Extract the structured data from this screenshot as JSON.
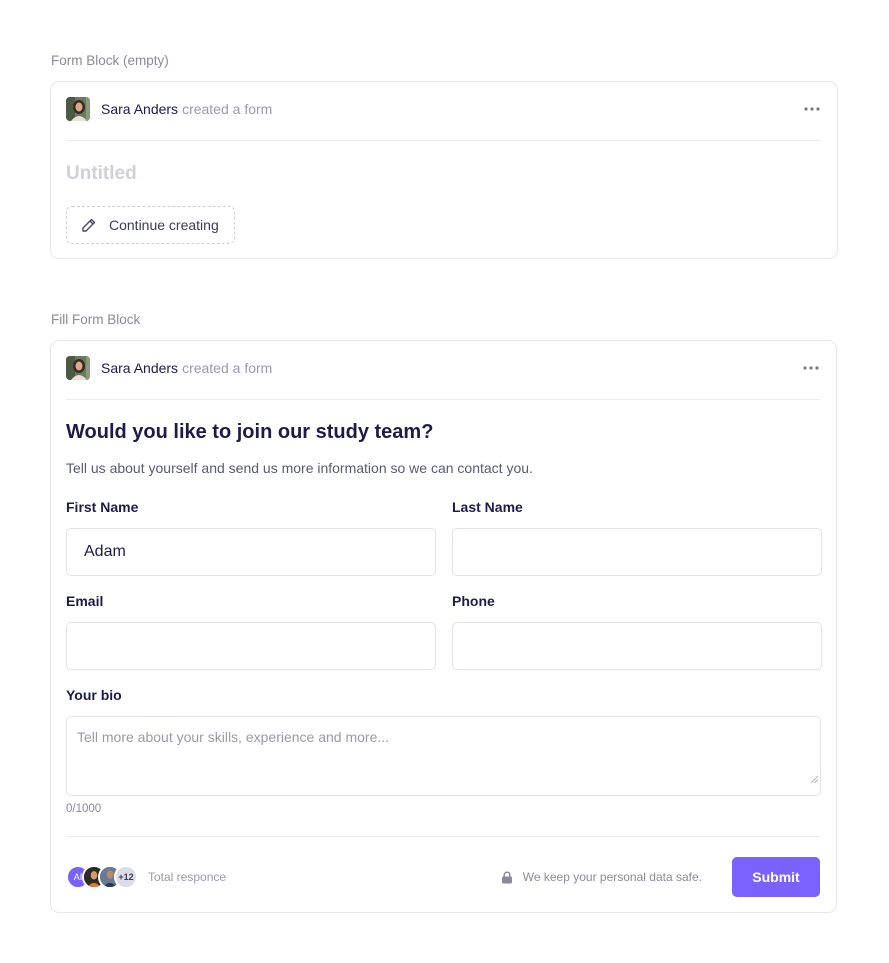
{
  "empty_block": {
    "section_label": "Form Block (empty)",
    "author": "Sara Anders",
    "action": "created a form",
    "title": "Untitled",
    "continue_label": "Continue creating"
  },
  "fill_block": {
    "section_label": "Fill Form Block",
    "author": "Sara Anders",
    "action": "created a form",
    "title": "Would you like to join our study team?",
    "description": "Tell us about yourself and send us more information so we can contact you.",
    "fields": {
      "first_name": {
        "label": "First Name",
        "value": "Adam"
      },
      "last_name": {
        "label": "Last Name",
        "value": ""
      },
      "email": {
        "label": "Email",
        "value": ""
      },
      "phone": {
        "label": "Phone",
        "value": ""
      },
      "bio": {
        "label": "Your bio",
        "placeholder": "Tell more about your skills, experience and more...",
        "counter": "0/1000"
      }
    },
    "footer": {
      "avatar_initials": "AI",
      "extra_count": "+12",
      "total_label": "Total responce",
      "privacy_text": "We keep your personal data safe.",
      "submit_label": "Submit"
    }
  },
  "colors": {
    "accent": "#7b61ff",
    "text_dark": "#1e1b4b",
    "text_muted": "#9a9aac",
    "border": "#e6e6ee"
  },
  "icons": [
    "more-horizontal-icon",
    "pencil-icon",
    "lock-icon",
    "resize-grip-icon"
  ]
}
